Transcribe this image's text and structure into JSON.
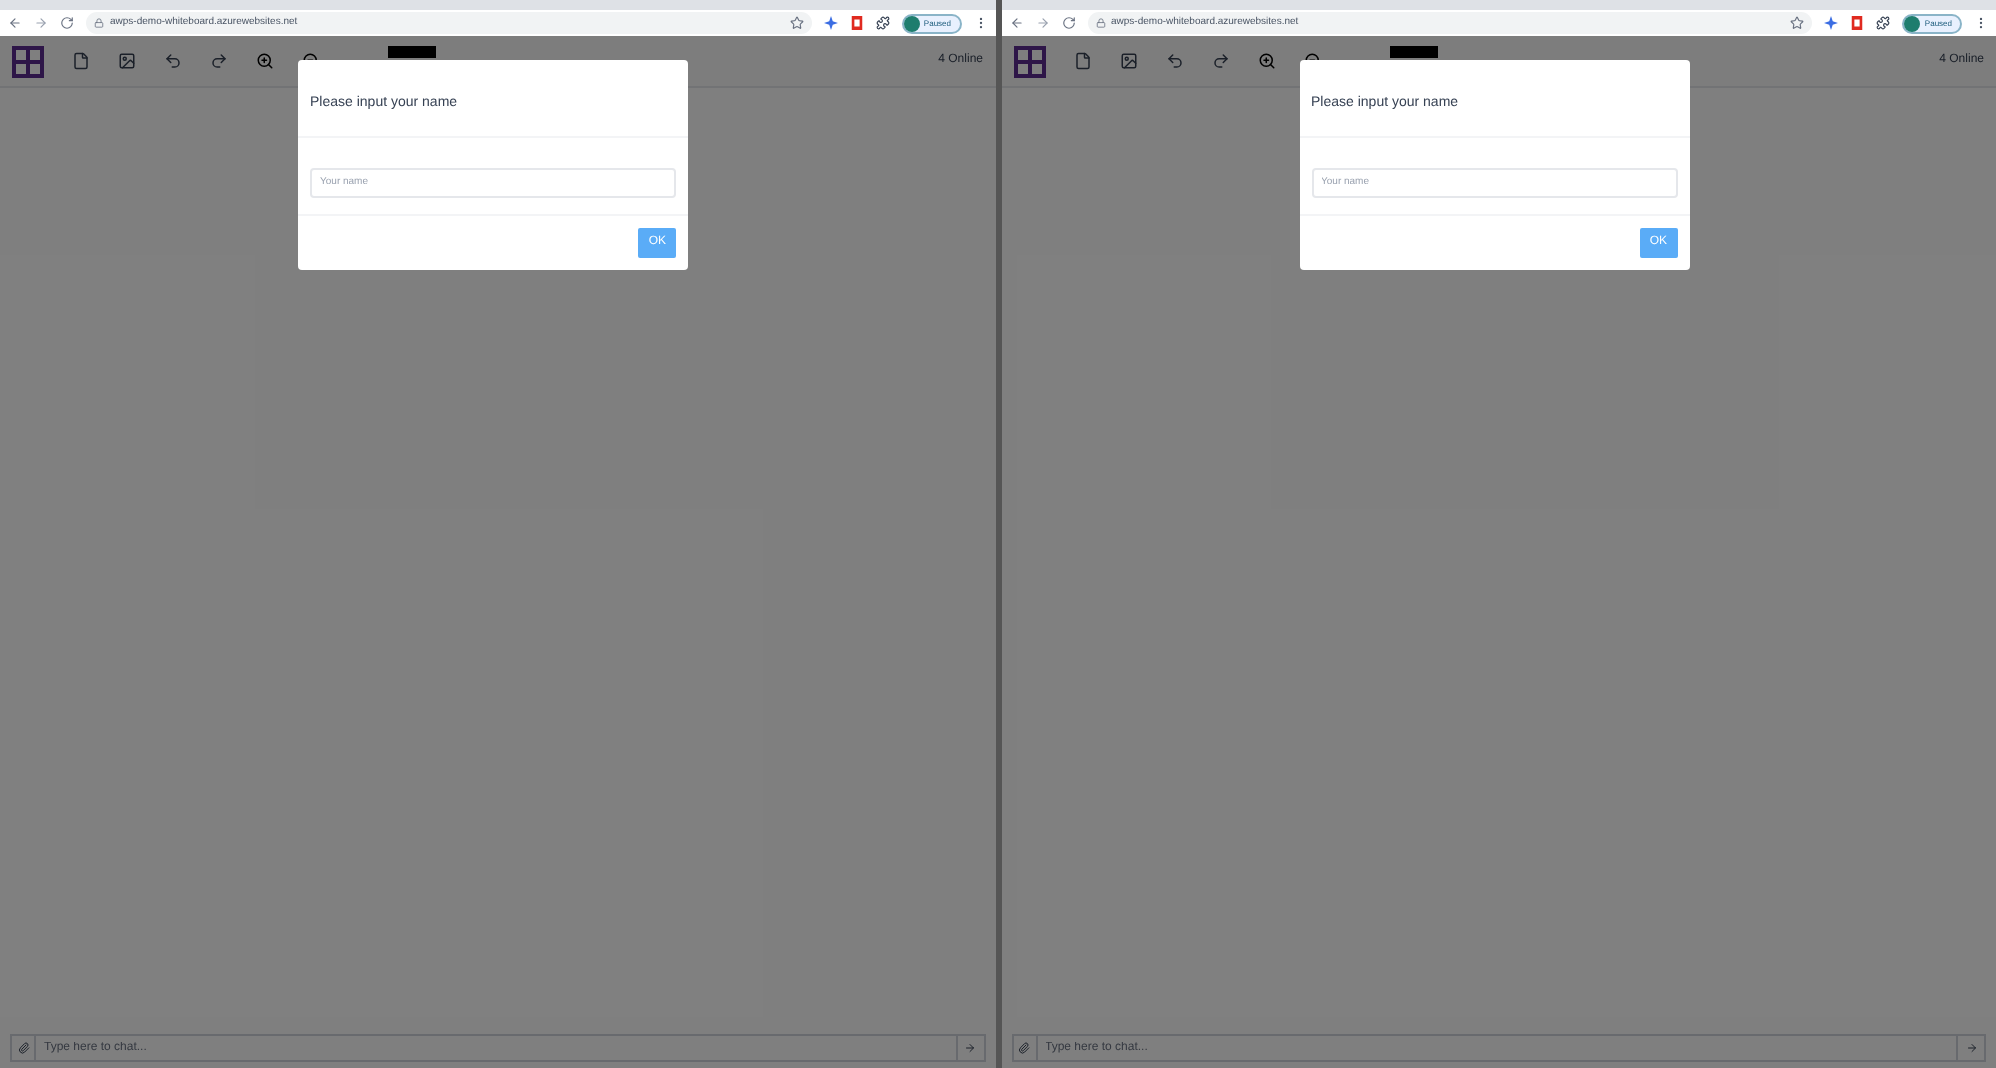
{
  "windows": [
    {
      "url": "awps-demo-whiteboard.azurewebsites.net",
      "profile": "Paused",
      "online": "4 Online",
      "dialog": {
        "title": "Please input your name",
        "placeholder": "Your name",
        "button": "OK"
      },
      "chat": {
        "placeholder": "Type here to chat..."
      }
    },
    {
      "url": "awps-demo-whiteboard.azurewebsites.net",
      "profile": "Paused",
      "online": "4 Online",
      "dialog": {
        "title": "Please input your name",
        "placeholder": "Your name",
        "button": "OK"
      },
      "chat": {
        "placeholder": "Type here to chat..."
      }
    }
  ]
}
